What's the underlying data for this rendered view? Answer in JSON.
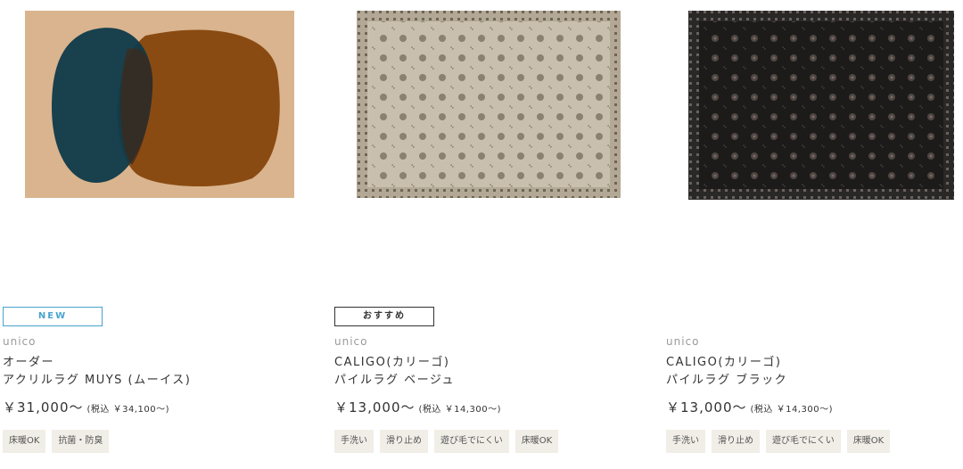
{
  "products": [
    {
      "badge": "NEW",
      "brand": "unico",
      "name_line1": "オーダー",
      "name_line2": "アクリルラグ MUYS (ムーイス)",
      "price": "￥31,000～",
      "price_tax": "(税込 ￥34,100～)",
      "tags": [
        "床暖OK",
        "抗菌・防臭"
      ],
      "image_alt": "rug-muys-image"
    },
    {
      "badge": "おすすめ",
      "brand": "unico",
      "name_line1": "CALIGO(カリーゴ)",
      "name_line2": "パイルラグ ベージュ",
      "price": "￥13,000～",
      "price_tax": "(税込 ￥14,300～)",
      "tags": [
        "手洗い",
        "滑り止め",
        "遊び毛でにくい",
        "床暖OK"
      ],
      "image_alt": "rug-caligo-beige-image"
    },
    {
      "badge": "",
      "brand": "unico",
      "name_line1": "CALIGO(カリーゴ)",
      "name_line2": "パイルラグ ブラック",
      "price": "￥13,000～",
      "price_tax": "(税込 ￥14,300～)",
      "tags": [
        "手洗い",
        "滑り止め",
        "遊び毛でにくい",
        "床暖OK"
      ],
      "image_alt": "rug-caligo-black-image"
    }
  ],
  "colors": {
    "new_badge": "#4aa3cf",
    "tag_bg": "#f1eee8",
    "brand_text": "#9a9a9a",
    "rug1_bg": "#d9b48e",
    "rug1_teal": "#0f3a4a",
    "rug1_brown": "#8a4b12",
    "rug2_bg": "#c8bfae",
    "rug3_bg": "#1c1b1a"
  }
}
